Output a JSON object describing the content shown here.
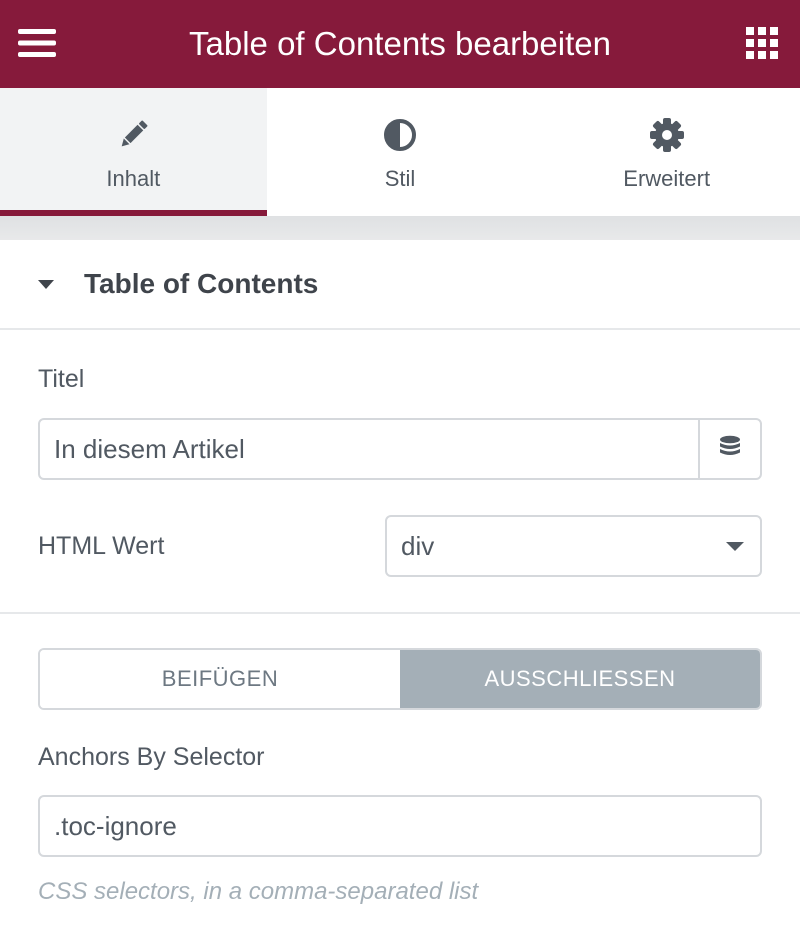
{
  "header": {
    "title": "Table of Contents bearbeiten",
    "menu_icon": "hamburger-icon",
    "grid_icon": "apps-grid-icon",
    "background": "#861a3b"
  },
  "tabs": [
    {
      "label": "Inhalt",
      "icon": "pencil-icon",
      "active": true
    },
    {
      "label": "Stil",
      "icon": "half-circle-icon",
      "active": false
    },
    {
      "label": "Erweitert",
      "icon": "gear-icon",
      "active": false
    }
  ],
  "section": {
    "title": "Table of Contents",
    "expanded": true
  },
  "fields": {
    "title_label": "Titel",
    "title_value": "In diesem Artikel",
    "html_label": "HTML Wert",
    "html_value": "div",
    "anchors_label": "Anchors By Selector",
    "anchors_value": ".toc-ignore",
    "anchors_hint": "CSS selectors, in a comma-separated list"
  },
  "toggle": {
    "options": [
      "BEIFÜGEN",
      "AUSSCHLIESSEN"
    ],
    "selected": "AUSSCHLIESSEN"
  }
}
